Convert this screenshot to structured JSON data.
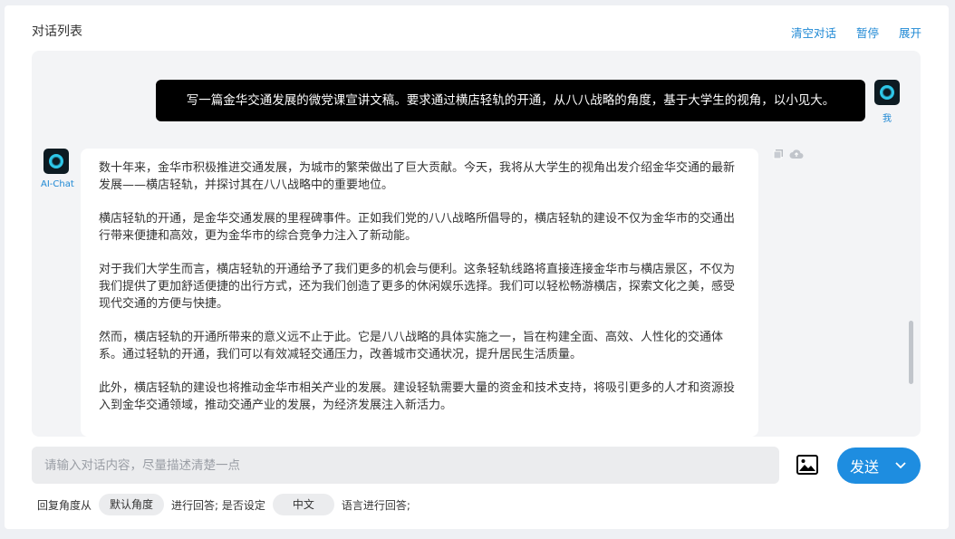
{
  "header": {
    "title": "对话列表",
    "actions": [
      "清空对话",
      "暂停",
      "展开"
    ]
  },
  "conversation": {
    "user": {
      "name": "我",
      "message": "写一篇金华交通发展的微党课宣讲文稿。要求通过横店轻轨的开通，从八八战略的角度，基于大学生的视角，以小见大。"
    },
    "assistant": {
      "name": "AI-Chat",
      "paragraphs": [
        "数十年来，金华市积极推进交通发展，为城市的繁荣做出了巨大贡献。今天，我将从大学生的视角出发介绍金华交通的最新发展——横店轻轨，并探讨其在八八战略中的重要地位。",
        "横店轻轨的开通，是金华交通发展的里程碑事件。正如我们党的八八战略所倡导的，横店轻轨的建设不仅为金华市的交通出行带来便捷和高效，更为金华市的综合竞争力注入了新动能。",
        "对于我们大学生而言，横店轻轨的开通给予了我们更多的机会与便利。这条轻轨线路将直接连接金华市与横店景区，不仅为我们提供了更加舒适便捷的出行方式，还为我们创造了更多的休闲娱乐选择。我们可以轻松畅游横店，探索文化之美，感受现代交通的方便与快捷。",
        "然而，横店轻轨的开通所带来的意义远不止于此。它是八八战略的具体实施之一，旨在构建全面、高效、人性化的交通体系。通过轻轨的开通，我们可以有效减轻交通压力，改善城市交通状况，提升居民生活质量。",
        "此外，横店轻轨的建设也将推动金华市相关产业的发展。建设轻轨需要大量的资金和技术支持，将吸引更多的人才和资源投入到金华交通领域，推动交通产业的发展，为经济发展注入新活力。"
      ]
    }
  },
  "input": {
    "placeholder": "请输入对话内容，尽量描述清楚一点",
    "value": ""
  },
  "send_button": {
    "label": "发送"
  },
  "footer": {
    "prefix": "回复角度从",
    "angle_value": "默认角度",
    "middle": "进行回答; 是否设定",
    "language_value": "中文",
    "suffix": "语言进行回答;"
  },
  "colors": {
    "accent": "#1e8de0",
    "link": "#1e88d4",
    "user_bubble": "#000000"
  },
  "icons": [
    "copy-icon",
    "cloud-icon",
    "image-icon",
    "chevron-down-icon",
    "avatar-icon"
  ]
}
